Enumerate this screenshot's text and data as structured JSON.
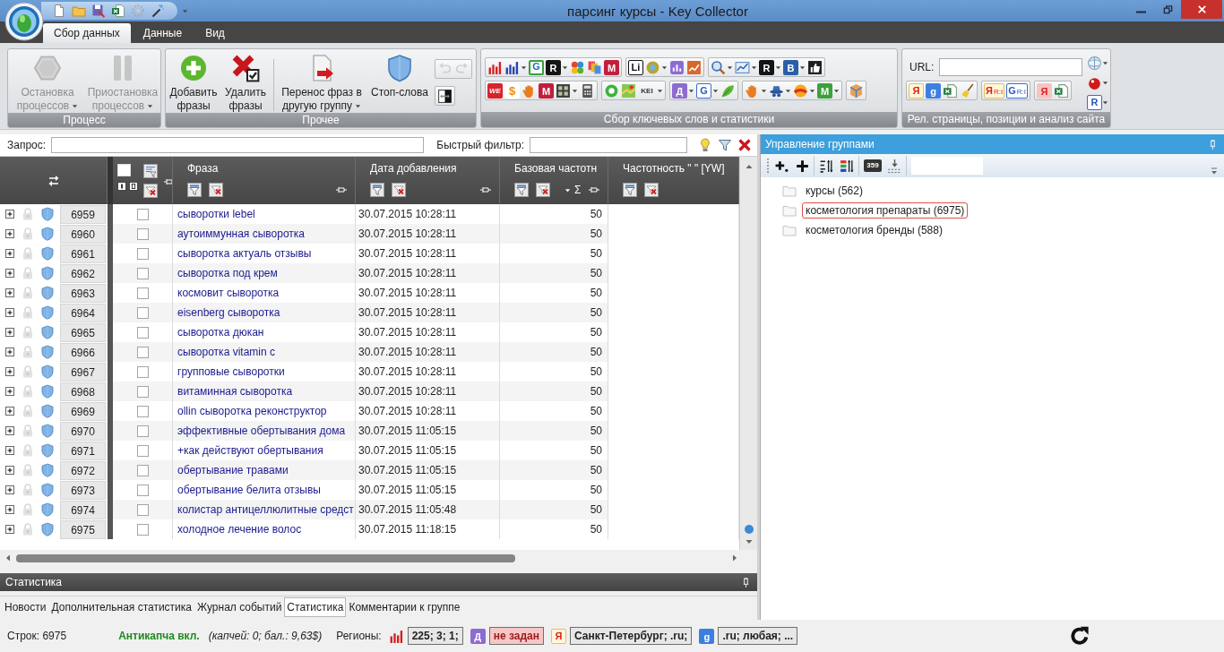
{
  "window": {
    "title": "парсинг курсы - Key Collector",
    "quick_access": [
      {
        "disabled": false
      },
      {
        "disabled": false
      },
      {
        "disabled": false
      },
      {
        "disabled": false
      },
      {
        "disabled": true
      },
      {
        "disabled": false
      }
    ]
  },
  "ribbon": {
    "tabs": [
      {
        "label": "Сбор данных",
        "selected": true
      },
      {
        "label": "Данные",
        "selected": false
      },
      {
        "label": "Вид",
        "selected": false
      }
    ],
    "groups": [
      {
        "title": "Процесс",
        "kind": "large",
        "buttons": [
          {
            "label": "Остановка процессов",
            "disabled": true,
            "dropdown": true
          },
          {
            "label": "Приостановка процессов",
            "disabled": true,
            "dropdown": true
          }
        ]
      },
      {
        "title": "Прочее",
        "kind": "large",
        "buttons": [
          {
            "label": "Добавить фразы",
            "disabled": false,
            "dropdown": false
          },
          {
            "label": "Удалить фразы",
            "disabled": false,
            "dropdown": false
          },
          {
            "label": "Перенос фраз в другую группу",
            "disabled": false,
            "dropdown": true
          },
          {
            "label": "Стоп-слова",
            "disabled": false,
            "dropdown": false
          }
        ],
        "side_rows": [
          [
            {
              "kind": "icon",
              "disabled": true,
              "dropdown": false
            },
            {
              "kind": "icon",
              "disabled": true,
              "dropdown": false
            }
          ],
          [
            {
              "kind": "icon",
              "disabled": false,
              "dropdown": false
            }
          ]
        ]
      },
      {
        "title": "Сбор ключевых слов и статистики",
        "kind": "tools",
        "rows": [
          [
            [
              {
                "kind": "icon",
                "dropdown": false
              },
              {
                "kind": "icon",
                "dropdown": true
              },
              {
                "kind": "letter",
                "glyph": "G",
                "dropdown": false
              },
              {
                "kind": "letter",
                "glyph": "R",
                "dropdown": true
              },
              {
                "kind": "icon",
                "dropdown": false
              },
              {
                "kind": "icon",
                "dropdown": false
              },
              {
                "kind": "letter",
                "glyph": "M",
                "dropdown": false
              }
            ],
            [
              {
                "kind": "letter",
                "glyph": "Li",
                "dropdown": false
              },
              {
                "kind": "icon",
                "dropdown": true
              },
              {
                "kind": "icon",
                "dropdown": false
              },
              {
                "kind": "icon",
                "dropdown": false
              }
            ],
            [
              {
                "kind": "icon",
                "dropdown": true
              },
              {
                "kind": "icon",
                "dropdown": true
              },
              {
                "kind": "letter",
                "glyph": "R",
                "dropdown": true
              },
              {
                "kind": "letter",
                "glyph": "B",
                "dropdown": true
              },
              {
                "kind": "icon",
                "dropdown": false
              }
            ]
          ],
          [
            [
              {
                "kind": "letter",
                "glyph": "WE",
                "dropdown": false
              },
              {
                "kind": "letter",
                "glyph": "$",
                "dropdown": false
              },
              {
                "kind": "icon",
                "dropdown": false
              },
              {
                "kind": "letter",
                "glyph": "M",
                "dropdown": false
              },
              {
                "kind": "icon",
                "dropdown": true
              },
              {
                "kind": "icon",
                "dropdown": false
              }
            ],
            [
              {
                "kind": "icon",
                "dropdown": false
              },
              {
                "kind": "icon",
                "dropdown": false
              },
              {
                "kind": "letter",
                "glyph": "KEI",
                "dropdown": true
              }
            ],
            [
              {
                "kind": "letter",
                "glyph": "Д",
                "dropdown": true
              },
              {
                "kind": "letter",
                "glyph": "G",
                "dropdown": true
              },
              {
                "kind": "icon",
                "dropdown": false
              }
            ],
            [
              {
                "kind": "icon",
                "dropdown": true
              },
              {
                "kind": "icon",
                "dropdown": true
              },
              {
                "kind": "icon",
                "dropdown": true
              },
              {
                "kind": "letter",
                "glyph": "M",
                "dropdown": true
              }
            ],
            [
              {
                "kind": "icon",
                "dropdown": false
              }
            ]
          ]
        ]
      },
      {
        "title": "Рел. страницы, позиции и анализ сайта",
        "kind": "tools",
        "url_label": "URL:",
        "rows": [
          [
            [
              {
                "kind": "letter",
                "glyph": "Я",
                "dropdown": false
              },
              {
                "kind": "letter",
                "glyph": "g",
                "dropdown": false
              },
              {
                "kind": "icon",
                "dropdown": false
              },
              {
                "kind": "icon",
                "dropdown": false
              }
            ],
            [
              {
                "kind": "letter",
                "glyph": "Я",
                "sub": "R:I",
                "dropdown": false
              },
              {
                "kind": "letter",
                "glyph": "G",
                "sub": "R:I",
                "dropdown": false
              }
            ],
            [
              {
                "kind": "letter",
                "glyph": "Я",
                "dropdown": false
              },
              {
                "kind": "icon",
                "dropdown": false
              }
            ]
          ]
        ],
        "side_tools": [
          {
            "kind": "icon",
            "dropdown": true
          },
          {
            "kind": "icon",
            "dropdown": true
          },
          {
            "kind": "letter",
            "glyph": "R",
            "dropdown": true
          }
        ]
      }
    ]
  },
  "filter_bar": {
    "query_label": "Запрос:",
    "quick_filter_label": "Быстрый фильтр:"
  },
  "table": {
    "select_all": {
      "checked": false
    },
    "columns": [
      {
        "label": "Фраза"
      },
      {
        "label": "Дата добавления"
      },
      {
        "label": "Базовая частотн",
        "aggregate": "Σ"
      },
      {
        "label": "Частотность \" \" [YW]"
      }
    ],
    "rows": [
      {
        "number": "6959",
        "checked": false,
        "phrase": "сыворотки lebel",
        "date": "30.07.2015 10:28:11",
        "base_frequency": "50"
      },
      {
        "number": "6960",
        "checked": false,
        "phrase": "аутоиммунная сыворотка",
        "date": "30.07.2015 10:28:11",
        "base_frequency": "50"
      },
      {
        "number": "6961",
        "checked": false,
        "phrase": "сыворотка актуаль отзывы",
        "date": "30.07.2015 10:28:11",
        "base_frequency": "50"
      },
      {
        "number": "6962",
        "checked": false,
        "phrase": "сыворотка под крем",
        "date": "30.07.2015 10:28:11",
        "base_frequency": "50"
      },
      {
        "number": "6963",
        "checked": false,
        "phrase": "космовит сыворотка",
        "date": "30.07.2015 10:28:11",
        "base_frequency": "50"
      },
      {
        "number": "6964",
        "checked": false,
        "phrase": "eisenberg сыворотка",
        "date": "30.07.2015 10:28:11",
        "base_frequency": "50"
      },
      {
        "number": "6965",
        "checked": false,
        "phrase": "сыворотка дюкан",
        "date": "30.07.2015 10:28:11",
        "base_frequency": "50"
      },
      {
        "number": "6966",
        "checked": false,
        "phrase": "сыворотка vitamin c",
        "date": "30.07.2015 10:28:11",
        "base_frequency": "50"
      },
      {
        "number": "6967",
        "checked": false,
        "phrase": "групповые сыворотки",
        "date": "30.07.2015 10:28:11",
        "base_frequency": "50"
      },
      {
        "number": "6968",
        "checked": false,
        "phrase": "витаминная сыворотка",
        "date": "30.07.2015 10:28:11",
        "base_frequency": "50"
      },
      {
        "number": "6969",
        "checked": false,
        "phrase": "ollin сыворотка реконструктор",
        "date": "30.07.2015 10:28:11",
        "base_frequency": "50"
      },
      {
        "number": "6970",
        "checked": false,
        "phrase": "эффективные обертывания дома",
        "date": "30.07.2015 11:05:15",
        "base_frequency": "50"
      },
      {
        "number": "6971",
        "checked": false,
        "phrase": "+как действуют обертывания",
        "date": "30.07.2015 11:05:15",
        "base_frequency": "50"
      },
      {
        "number": "6972",
        "checked": false,
        "phrase": "обертывание травами",
        "date": "30.07.2015 11:05:15",
        "base_frequency": "50"
      },
      {
        "number": "6973",
        "checked": false,
        "phrase": "обертывание белита отзывы",
        "date": "30.07.2015 11:05:15",
        "base_frequency": "50"
      },
      {
        "number": "6974",
        "checked": false,
        "phrase": "колистар антицеллюлитные средст",
        "date": "30.07.2015 11:05:48",
        "base_frequency": "50"
      },
      {
        "number": "6975",
        "checked": false,
        "phrase": "холодное лечение волос",
        "date": "30.07.2015 11:18:15",
        "base_frequency": "50"
      }
    ]
  },
  "statistics_panel": {
    "title": "Статистика",
    "tabs": [
      {
        "label": "Новости",
        "selected": false
      },
      {
        "label": "Дополнительная статистика",
        "selected": false
      },
      {
        "label": "Журнал событий",
        "selected": false
      },
      {
        "label": "Статистика",
        "selected": true
      },
      {
        "label": "Комментарии к группе",
        "selected": false
      }
    ]
  },
  "group_panel": {
    "title": "Управление группами",
    "tools": [
      [
        {
          "kind": "icon"
        },
        {
          "kind": "icon"
        }
      ],
      [
        {
          "kind": "icon"
        },
        {
          "kind": "icon"
        }
      ],
      [
        {
          "kind": "letter",
          "glyph": "359"
        },
        {
          "kind": "icon"
        }
      ]
    ],
    "groups": [
      {
        "label": "курсы (562)",
        "selected": false
      },
      {
        "label": "косметология препараты (6975)",
        "selected": true
      },
      {
        "label": "косметология бренды (588)",
        "selected": false
      }
    ]
  },
  "status_bar": {
    "row_count": "Строк: 6975",
    "anticaptcha": {
      "label": "Антикапча вкл.",
      "on": true,
      "details": "(капчей: 0; бал.: 9,63$)"
    },
    "regions_label": "Регионы:",
    "regions": [
      {
        "kind": "icon",
        "value": "225; 3; 1;",
        "warning": false
      },
      {
        "kind": "letter",
        "glyph": "Д",
        "value": "не задан",
        "warning": true
      },
      {
        "kind": "letter",
        "glyph": "Я",
        "value": "Санкт-Петербург; .ru;",
        "warning": false
      },
      {
        "kind": "letter",
        "glyph": "g",
        "value": ".ru; любая; ...",
        "warning": false
      }
    ]
  }
}
